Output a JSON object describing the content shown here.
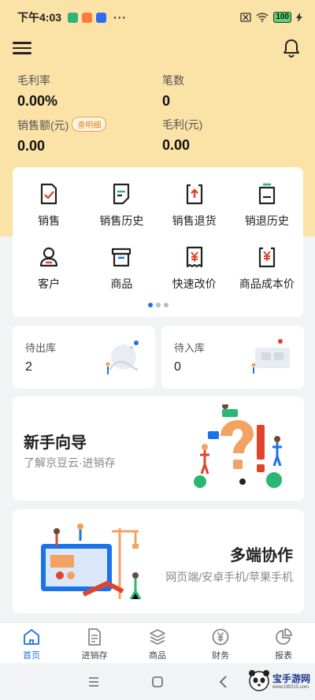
{
  "status_bar": {
    "time": "下午4:03",
    "dots": "···",
    "battery": "100",
    "colors": {
      "app1": "#2bb673",
      "app2": "#ff7a3d",
      "app3": "#2b6cf5"
    }
  },
  "header": {
    "menu_icon": "hamburger-icon",
    "bell_icon": "bell-icon"
  },
  "stats": {
    "gross_margin_rate": {
      "label": "毛利率",
      "value": "0.00%"
    },
    "count": {
      "label": "笔数",
      "value": "0"
    },
    "sales": {
      "label": "销售额(元)",
      "value": "0.00",
      "detail_button": "查明细"
    },
    "gross_profit": {
      "label": "毛利(元)",
      "value": "0.00"
    }
  },
  "menu": {
    "items": [
      {
        "label": "销售",
        "icon": "sales-icon"
      },
      {
        "label": "销售历史",
        "icon": "sales-history-icon"
      },
      {
        "label": "销售退货",
        "icon": "sales-return-icon"
      },
      {
        "label": "销退历史",
        "icon": "return-history-icon"
      },
      {
        "label": "客户",
        "icon": "customer-icon"
      },
      {
        "label": "商品",
        "icon": "product-icon"
      },
      {
        "label": "快速改价",
        "icon": "quick-price-icon"
      },
      {
        "label": "商品成本价",
        "icon": "cost-price-icon"
      }
    ],
    "page_dots": {
      "count": 3,
      "active": 1
    }
  },
  "stock": {
    "outbound": {
      "label": "待出库",
      "value": "2"
    },
    "inbound": {
      "label": "待入库",
      "value": "0"
    }
  },
  "guide": {
    "title": "新手向导",
    "subtitle": "了解京豆云·进销存"
  },
  "multi_device": {
    "title": "多端协作",
    "subtitle": "网页端/安卓手机/苹果手机"
  },
  "tabs": [
    {
      "label": "首页",
      "icon": "home-icon",
      "active": true
    },
    {
      "label": "进销存",
      "icon": "document-icon",
      "active": false
    },
    {
      "label": "商品",
      "icon": "layers-icon",
      "active": false
    },
    {
      "label": "财务",
      "icon": "yen-coin-icon",
      "active": false
    },
    {
      "label": "报表",
      "icon": "pie-chart-icon",
      "active": false
    }
  ],
  "watermark": {
    "text": "宝手游网",
    "url": "www.GB315.com"
  },
  "colors": {
    "accent": "#1a73e8",
    "icon_dark": "#222222",
    "icon_red": "#e0452b",
    "icon_green": "#2bb673",
    "header_bg": "#fbe2a6"
  }
}
